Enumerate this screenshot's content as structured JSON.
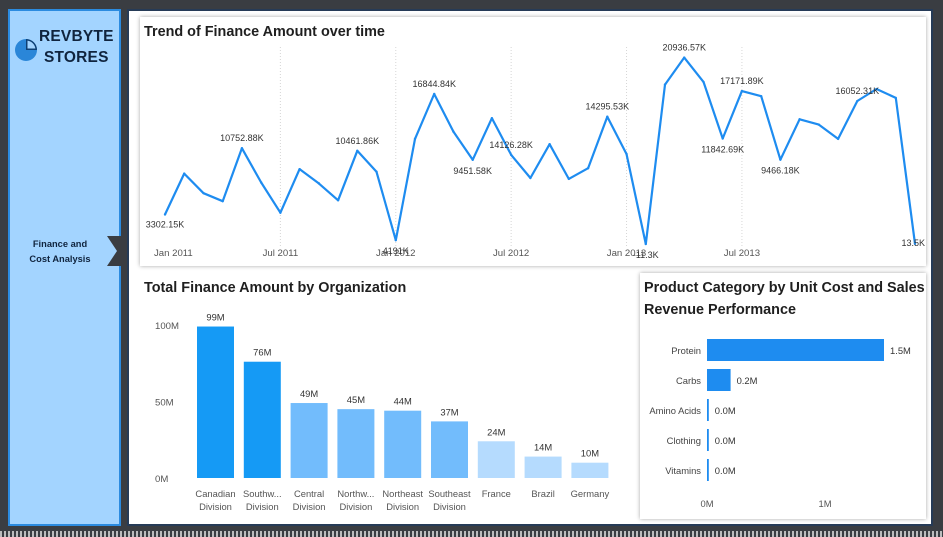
{
  "sidebar": {
    "brand_line1": "REVBYTE",
    "brand_line2": "STORES",
    "logo_icon": "pie-chart-logo-icon",
    "nav_item_line1": "Finance and",
    "nav_item_line2": "Cost Analysis",
    "nav_arrow_icon": "chevron-right-icon",
    "accent": "#a3d4ff"
  },
  "colors": {
    "line": "#1e8cf0",
    "bar_dark": "#159af5",
    "bar_mid": "#72bcfc",
    "bar_light": "#b5dbfe",
    "bar_h": "#1e8cf0"
  },
  "trend": {
    "title": "Trend of Finance Amount over time",
    "chart_data": {
      "type": "line",
      "title": "Trend of Finance Amount over time",
      "x_ticks": [
        "Jan 2011",
        "Jul 2011",
        "Jan 2012",
        "Jul 2012",
        "Jan 2013",
        "Jul 2013"
      ],
      "series": [
        {
          "values": [
            3302.15,
            7900,
            5700,
            4800,
            10752.88,
            6900,
            3500,
            8400,
            6800,
            4900,
            10461.86,
            8100,
            419.1,
            11800,
            16844.84,
            12600,
            9451.58,
            14126.28,
            10000,
            7400,
            11200,
            7300,
            8500,
            14295.53,
            10100,
            -11.3,
            17900,
            20936.57,
            18200,
            11842.69,
            17171.89,
            16600,
            9466.18,
            14000,
            13400,
            11800,
            16052.31,
            17400,
            16400,
            13.5
          ]
        }
      ],
      "data_labels": [
        {
          "index": 0,
          "text": "3302.15K"
        },
        {
          "index": 4,
          "text": "10752.88K"
        },
        {
          "index": 10,
          "text": "10461.86K"
        },
        {
          "index": 12,
          "text": "4191K"
        },
        {
          "index": 14,
          "text": "16844.84K"
        },
        {
          "index": 16,
          "text": "9451.58K"
        },
        {
          "index": 18,
          "text": "14126.28K"
        },
        {
          "index": 23,
          "text": "14295.53K"
        },
        {
          "index": 25,
          "text": "-11.3K"
        },
        {
          "index": 27,
          "text": "20936.57K"
        },
        {
          "index": 29,
          "text": "11842.69K"
        },
        {
          "index": 30,
          "text": "17171.89K"
        },
        {
          "index": 32,
          "text": "9466.18K"
        },
        {
          "index": 36,
          "text": "16052.31K"
        },
        {
          "index": 39,
          "text": "13.5K"
        }
      ],
      "grid": "vertical dotted"
    }
  },
  "org": {
    "title": "Total Finance Amount by Organization",
    "chart_data": {
      "type": "bar",
      "title": "Total Finance Amount by Organization",
      "categories": [
        "Canadian\nDivision",
        "Southw...\nDivision",
        "Central\nDivision",
        "Northw...\nDivision",
        "Northeast\nDivision",
        "Southeast\nDivision",
        "France",
        "Brazil",
        "Germany"
      ],
      "values": [
        99,
        76,
        49,
        45,
        44,
        37,
        24,
        14,
        10
      ],
      "data_labels": [
        "99M",
        "76M",
        "49M",
        "45M",
        "44M",
        "37M",
        "24M",
        "14M",
        "10M"
      ],
      "y_ticks": [
        "0M",
        "50M",
        "100M"
      ],
      "ylim": [
        0,
        100
      ]
    }
  },
  "product": {
    "title_line1": "Product Category by Unit Cost and Sales",
    "title_line2": "Revenue Performance",
    "chart_data": {
      "type": "bar",
      "orientation": "horizontal",
      "title": "Product Category by Unit Cost and Sales Revenue Performance",
      "categories": [
        "Protein",
        "Carbs",
        "Amino Acids",
        "Clothing",
        "Vitamins"
      ],
      "values": [
        1.5,
        0.2,
        0.0,
        0.0,
        0.0
      ],
      "data_labels": [
        "1.5M",
        "0.2M",
        "0.0M",
        "0.0M",
        "0.0M"
      ],
      "x_ticks": [
        "0M",
        "1M"
      ],
      "xlim": [
        0,
        1.5
      ]
    }
  }
}
